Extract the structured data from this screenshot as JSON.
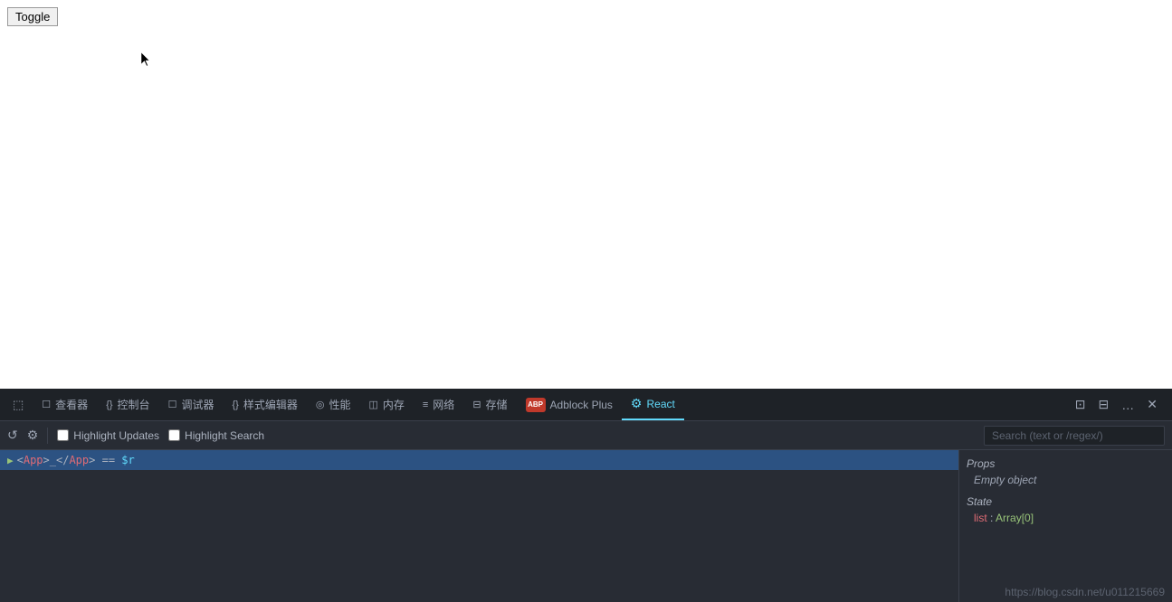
{
  "browser": {
    "toggle_button": "Toggle",
    "content_bg": "#ffffff"
  },
  "devtools": {
    "tabs": [
      {
        "id": "inspector",
        "icon": "☐",
        "label": "查看器",
        "active": false
      },
      {
        "id": "console",
        "icon": "{}",
        "label": "控制台",
        "active": false
      },
      {
        "id": "debugger",
        "icon": "☐",
        "label": "调试器",
        "active": false
      },
      {
        "id": "style-editor",
        "icon": "{}",
        "label": "样式编辑器",
        "active": false
      },
      {
        "id": "performance",
        "icon": "◎",
        "label": "性能",
        "active": false
      },
      {
        "id": "memory",
        "icon": "◫",
        "label": "内存",
        "active": false
      },
      {
        "id": "network",
        "icon": "≡",
        "label": "网络",
        "active": false
      },
      {
        "id": "storage",
        "icon": "⊟",
        "label": "存储",
        "active": false
      },
      {
        "id": "adblock",
        "icon": "ABP",
        "label": "Adblock Plus",
        "active": false
      },
      {
        "id": "react",
        "icon": "⚙",
        "label": "React",
        "active": true
      }
    ],
    "toolbar_right": {
      "split_icon": "⊡",
      "dock_icon": "⊟",
      "more_icon": "…",
      "close_icon": "✕"
    }
  },
  "react_toolbar": {
    "highlight_updates_label": "Highlight Updates",
    "highlight_search_label": "Highlight Search",
    "search_placeholder": "Search (text or /regex/)"
  },
  "component_tree": {
    "rows": [
      {
        "indent": 0,
        "content": "<App>_</App> == $r",
        "selected": true
      }
    ]
  },
  "right_panel": {
    "props_title": "Props",
    "props_value": "Empty object",
    "state_title": "State",
    "state_items": [
      {
        "key": "list",
        "value": "Array[0]"
      }
    ]
  },
  "watermark": "https://blog.csdn.net/u011215669"
}
